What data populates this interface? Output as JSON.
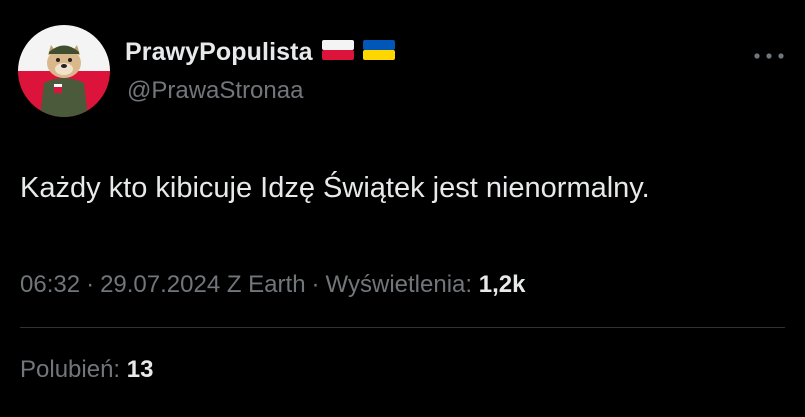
{
  "author": {
    "display_name": "PrawyPopulista",
    "handle": "@PrawaStronaa",
    "flags": [
      "poland-flag-icon",
      "ukraine-flag-icon"
    ],
    "avatar": "dog-soldier-avatar"
  },
  "tweet": {
    "text": "Każdy kto kibicuje Idzę Świątek jest nienormalny."
  },
  "meta": {
    "time": "06:32",
    "separator": "·",
    "date": "29.07.2024 Z Earth",
    "views_label": "Wyświetlenia:",
    "views_count": "1,2k"
  },
  "stats": {
    "likes_label": "Polubień:",
    "likes_count": "13"
  },
  "menu": {
    "more_icon": "more-dots-icon"
  },
  "colors": {
    "background": "#000000",
    "primary_text": "#e7e9ea",
    "secondary_text": "#71767b",
    "divider": "#2f3336",
    "poland_red": "#dc143c",
    "ukraine_blue": "#0057b7",
    "ukraine_yellow": "#ffd700"
  }
}
